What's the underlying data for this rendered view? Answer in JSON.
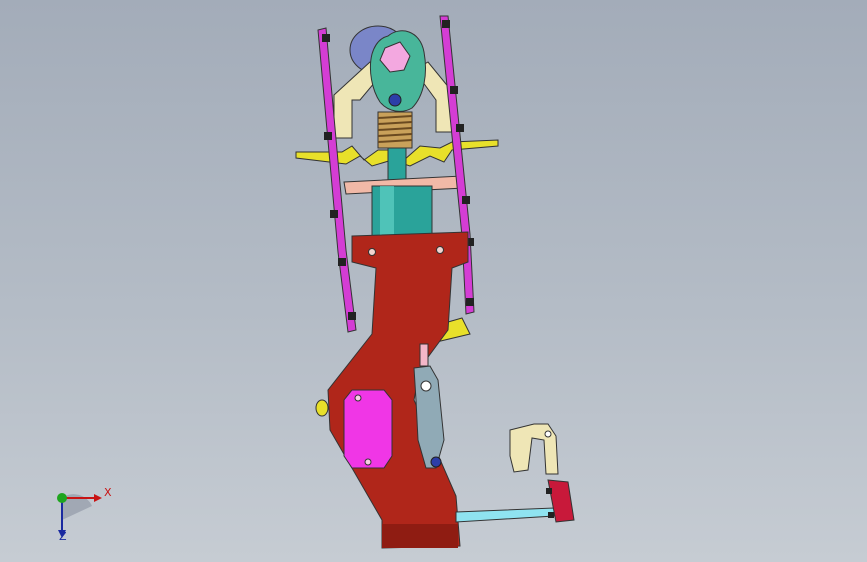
{
  "viewport": {
    "background_top": "#a3acb9",
    "background_bottom": "#c6ccd3"
  },
  "model": {
    "colors": {
      "frame": "#b0261a",
      "side_link": "#d43dd4",
      "cylinder": "#2aa39a",
      "spring": "#c9a15a",
      "cam": "#48b69a",
      "yellow_part": "#e8e02a",
      "cream_part": "#efe6b6",
      "magenta_block": "#f036e6",
      "rod": "#8fe3f0",
      "red_link": "#c8193a"
    }
  },
  "triad": {
    "x_label": "X",
    "z_label": "Z",
    "x_color": "#c81414",
    "y_color": "#1ea51e",
    "z_color": "#1a2aa0"
  }
}
